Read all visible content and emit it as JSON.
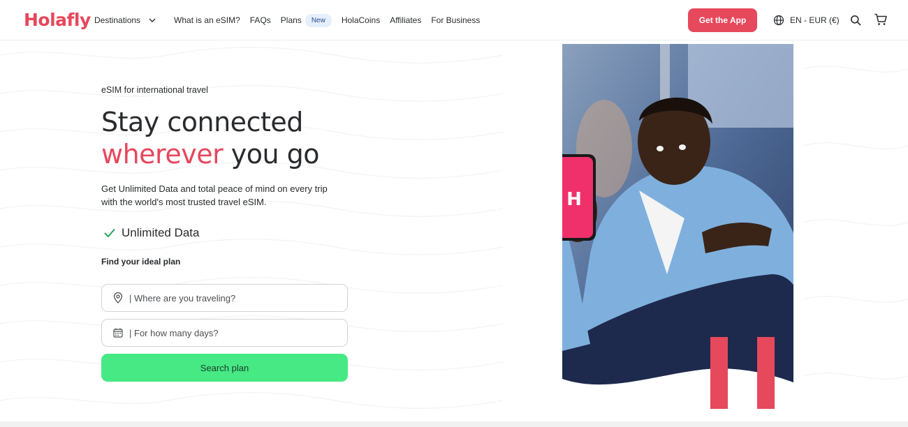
{
  "brand": {
    "logo_text": "Holafly",
    "accent": "#e6485c",
    "success": "#46e984"
  },
  "nav": {
    "items": [
      {
        "label": "Destinations",
        "has_dropdown": true
      },
      {
        "label": "What is an eSIM?"
      },
      {
        "label": "FAQs"
      },
      {
        "label": "Plans",
        "badge": "New"
      },
      {
        "label": "HolaCoins"
      },
      {
        "label": "Affiliates"
      },
      {
        "label": "For Business"
      }
    ]
  },
  "header": {
    "cta_label": "Get the App",
    "language": "EN - EUR (€)",
    "icons": [
      "globe-icon",
      "search-icon",
      "cart-icon"
    ]
  },
  "hero": {
    "eyebrow": "eSIM for international travel",
    "title_line1": "Stay connected",
    "title_accent": "wherever",
    "title_rest": " you go",
    "lead": "Get Unlimited Data and total peace of mind on every trip with the world's most trusted travel eSIM.",
    "feature": "Unlimited Data",
    "find_label": "Find your ideal plan",
    "destination_placeholder": "Where are you traveling?",
    "days_placeholder": "For how many days?",
    "search_label": "Search plan"
  }
}
